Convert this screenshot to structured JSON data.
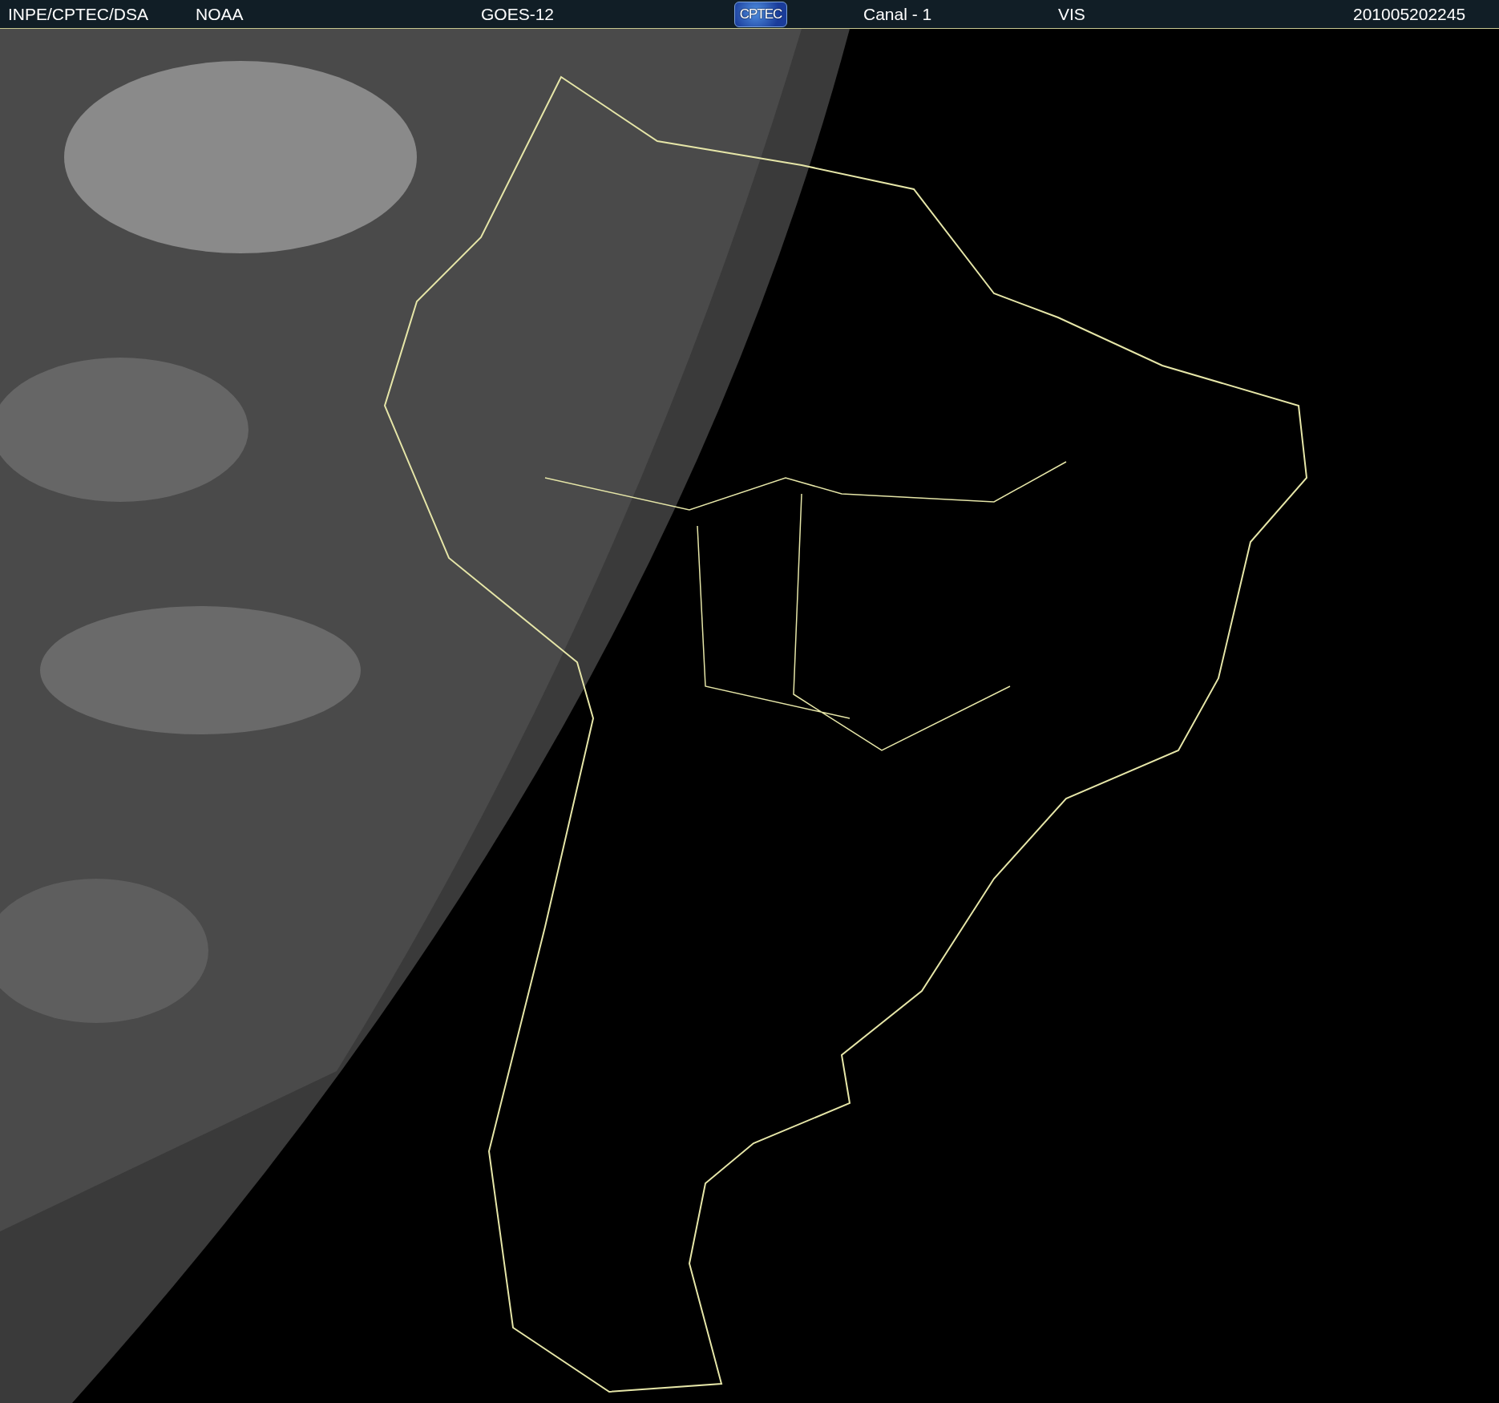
{
  "header": {
    "source": "INPE/CPTEC/DSA",
    "agency": "NOAA",
    "satellite": "GOES-12",
    "logo": "CPTEC",
    "channel": "Canal - 1",
    "band": "VIS",
    "timestamp": "201005202245"
  }
}
